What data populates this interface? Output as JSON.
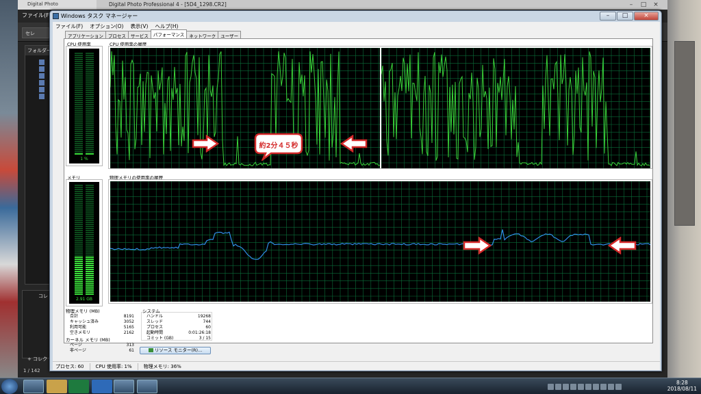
{
  "dpp": {
    "title": "Digital Photo Professional 4 - [5D4_1298.CR2]",
    "title_short": "Digital Photo",
    "menu_file": "ファイル(F)",
    "button_label": "セレ",
    "folder_label": "フォルダー",
    "collection_label": "コレ",
    "add_label": "+ コレク",
    "image_count": "1 / 142"
  },
  "taskmgr": {
    "title": "Windows タスク マネージャー",
    "menu": [
      "ファイル(F)",
      "オプション(O)",
      "表示(V)",
      "ヘルプ(H)"
    ],
    "tabs": [
      "アプリケーション",
      "プロセス",
      "サービス",
      "パフォーマンス",
      "ネットワーク",
      "ユーザー"
    ],
    "active_tab": 3,
    "cpu_usage_label": "CPU 使用率",
    "cpu_usage_value": "1 %",
    "cpu_history_label": "CPU 使用率の履歴",
    "memory_label": "メモリ",
    "memory_value": "2.91 GB",
    "memory_history_label": "物理メモリの使用率の履歴",
    "physical_memory": {
      "title": "物理メモリ (MB)",
      "rows": [
        {
          "label": "合計",
          "value": "8191"
        },
        {
          "label": "キャッシュ済み",
          "value": "3052"
        },
        {
          "label": "利用可能",
          "value": "5165"
        },
        {
          "label": "空きメモリ",
          "value": "2162"
        }
      ]
    },
    "kernel_memory": {
      "title": "カーネル メモリ (MB)",
      "rows": [
        {
          "label": "ページ",
          "value": "313"
        },
        {
          "label": "非ページ",
          "value": "61"
        }
      ]
    },
    "system": {
      "title": "システム",
      "rows": [
        {
          "label": "ハンドル",
          "value": "19268"
        },
        {
          "label": "スレッド",
          "value": "744"
        },
        {
          "label": "プロセス",
          "value": "60"
        },
        {
          "label": "起動時間",
          "value": "0:01:26:18"
        },
        {
          "label": "コミット (GB)",
          "value": "3 / 15"
        }
      ]
    },
    "resource_monitor_button": "リソース モニター(R)...",
    "status": {
      "processes": "プロセス: 60",
      "cpu": "CPU 使用率: 1%",
      "memory": "物理メモリ: 36%"
    },
    "cpu_meter_fraction": 0.01,
    "memory_meter_fraction": 0.36
  },
  "annotation": {
    "bubble_text": "約2分４５秒",
    "arrow_color": "#d42a2a"
  },
  "clock": {
    "time": "8:28",
    "date": "2018/08/11"
  },
  "colors": {
    "cpu_line": "#3ad43a",
    "grid": "#0a6e3a",
    "memory_line": "#2f8ee6"
  }
}
